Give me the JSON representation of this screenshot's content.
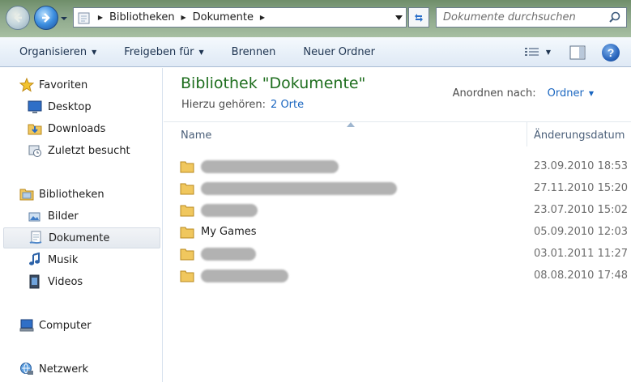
{
  "address": {
    "breadcrumbs": [
      "Bibliotheken",
      "Dokumente"
    ],
    "search_placeholder": "Dokumente durchsuchen"
  },
  "toolbar": {
    "organize": "Organisieren",
    "share": "Freigeben für",
    "burn": "Brennen",
    "new_folder": "Neuer Ordner",
    "help": "?"
  },
  "nav": {
    "favorites": "Favoriten",
    "desktop": "Desktop",
    "downloads": "Downloads",
    "recent": "Zuletzt besucht",
    "libraries": "Bibliotheken",
    "pictures": "Bilder",
    "documents": "Dokumente",
    "music": "Musik",
    "videos": "Videos",
    "computer": "Computer",
    "network": "Netzwerk"
  },
  "content": {
    "title": "Bibliothek \"Dokumente\"",
    "includes_label": "Hierzu gehören:",
    "includes_link": "2 Orte",
    "arrange_label": "Anordnen nach:",
    "arrange_value": "Ordner",
    "col_name": "Name",
    "col_date": "Änderungsdatum",
    "rows": [
      {
        "name": "",
        "date": "23.09.2010 18:53"
      },
      {
        "name": "",
        "date": "27.11.2010 15:20"
      },
      {
        "name": "",
        "date": "23.07.2010 15:02"
      },
      {
        "name": "My Games",
        "date": "05.09.2010 12:03"
      },
      {
        "name": "",
        "date": "03.01.2011 11:27"
      },
      {
        "name": "",
        "date": "08.08.2010 17:48"
      }
    ]
  },
  "colors": {
    "title_green": "#1e6e1e",
    "link_blue": "#1a66c0",
    "toolbar_text": "#1e3451"
  }
}
